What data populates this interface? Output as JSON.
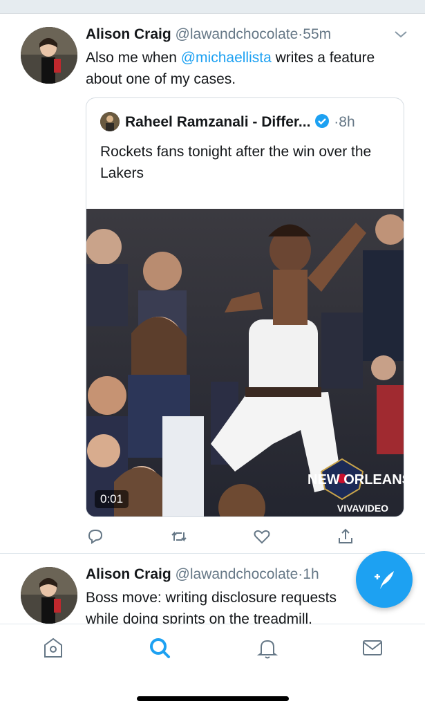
{
  "tweets": [
    {
      "author_name": "Alison Craig",
      "handle": "@lawandchocolate",
      "separator": "·",
      "time": "55m",
      "text_before": "Also me when ",
      "mention": "@michaellista",
      "text_after": " writes a feature about one of my cases.",
      "quoted": {
        "author_name": "Raheel Ramzanali - Differ...",
        "separator": "·",
        "time": "8h",
        "text": "Rockets fans tonight after the win over the Lakers",
        "video_duration": "0:01",
        "watermark_team": "NEW ORLEANS",
        "watermark_vendor": "VIVAVIDEO"
      }
    },
    {
      "author_name": "Alison Craig",
      "handle": "@lawandchocolate",
      "separator": "·",
      "time": "1h",
      "text": "Boss move: writing disclosure requests while doing sprints on the treadmill."
    }
  ],
  "colors": {
    "accent": "#1da1f2",
    "text_primary": "#14171a",
    "text_secondary": "#657786",
    "border": "#e1e8ed"
  },
  "icons": {
    "actions": [
      "reply-icon",
      "retweet-icon",
      "like-icon",
      "share-icon"
    ],
    "tabs": [
      "home-icon",
      "search-icon",
      "notifications-icon",
      "messages-icon"
    ],
    "fab": "compose-tweet-icon"
  }
}
